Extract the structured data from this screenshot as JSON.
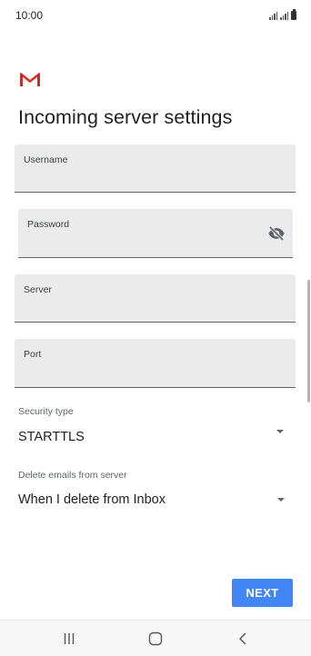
{
  "status_bar": {
    "time": "10:00"
  },
  "app": {
    "logo_icon": "gmail-icon",
    "brand_color": "#d93025"
  },
  "page": {
    "title": "Incoming server settings"
  },
  "fields": {
    "username": {
      "label": "Username",
      "value": ""
    },
    "password": {
      "label": "Password",
      "value": "",
      "toggle_icon": "visibility-off-icon"
    },
    "server": {
      "label": "Server",
      "value": ""
    },
    "port": {
      "label": "Port",
      "value": ""
    }
  },
  "security": {
    "label": "Security type",
    "value": "STARTTLS"
  },
  "delete_emails": {
    "label": "Delete emails from server",
    "value": "When I delete from Inbox"
  },
  "actions": {
    "next_label": "NEXT",
    "accent_color": "#4285f4"
  },
  "nav": {
    "recents_icon": "recents-icon",
    "home_icon": "home-icon",
    "back_icon": "back-icon"
  }
}
